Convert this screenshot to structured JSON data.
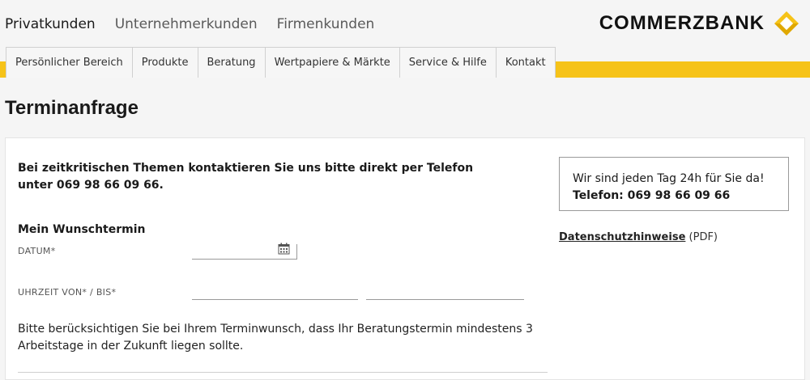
{
  "segments": [
    "Privatkunden",
    "Unternehmerkunden",
    "Firmenkunden"
  ],
  "active_segment": "Privatkunden",
  "logo": {
    "text": "COMMERZBANK",
    "icon": "commerzbank-ribbon-logo",
    "color": "#f6c319"
  },
  "tabs": [
    "Persönlicher Bereich",
    "Produkte",
    "Beratung",
    "Wertpapiere & Märkte",
    "Service & Hilfe",
    "Kontakt"
  ],
  "page_title": "Terminanfrage",
  "notice": "Bei zeitkritischen Themen kontaktieren Sie uns bitte direkt per Telefon unter 069 98 66 09 66.",
  "form": {
    "section_title": "Mein Wunschtermin",
    "date_label": "DATUM*",
    "time_label": "UHRZEIT VON* / BIS*",
    "date_value": "",
    "time_from_value": "",
    "time_to_value": ""
  },
  "hint": "Bitte berücksichtigen Sie bei Ihrem Terminwunsch, dass Ihr Beratungstermin mindestens 3 Arbeitstage in der Zukunft liegen sollte.",
  "contact_box": {
    "line1": "Wir sind jeden Tag 24h für Sie da!",
    "line2": "Telefon: 069 98 66 09 66"
  },
  "privacy": {
    "link": "Datenschutzhinweise",
    "suffix": "(PDF)"
  },
  "colors": {
    "accent": "#f6c319",
    "background": "#f5f5f5"
  }
}
